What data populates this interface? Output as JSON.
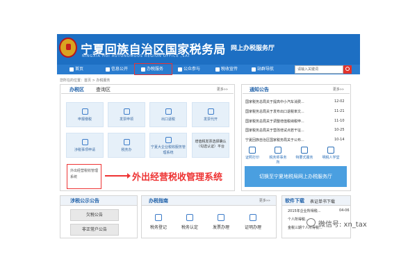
{
  "header": {
    "site_title": "宁夏回族自治区国家税务局",
    "site_title_en": "NINGXIA HUI AUTONOMOUS REGION OFFICE ,SAT",
    "hall_label": "网上办税服务厅"
  },
  "nav": {
    "items": [
      {
        "label": "首页",
        "icon": "home-icon"
      },
      {
        "label": "信息公开",
        "icon": "info-icon"
      },
      {
        "label": "办税服务",
        "icon": "edit-icon"
      },
      {
        "label": "公众参与",
        "icon": "people-icon"
      },
      {
        "label": "税收宣传",
        "icon": "news-icon"
      },
      {
        "label": "站群导航",
        "icon": "sitemap-icon"
      }
    ],
    "search_placeholder": "请输入关键词"
  },
  "breadcrumb": "您所在的位置：首页 > 办税服务",
  "tax_panel": {
    "tabs": [
      "办税区",
      "查询区"
    ],
    "more": "更多»»",
    "services": [
      {
        "label": "申报缴税",
        "icon": "declare-icon"
      },
      {
        "label": "发票申领",
        "icon": "invoice-icon"
      },
      {
        "label": "出口退税",
        "icon": "export-icon"
      },
      {
        "label": "发票代开",
        "icon": "print-icon"
      },
      {
        "label": "涉税事项申请",
        "icon": "apply-icon"
      },
      {
        "label": "税务办",
        "icon": "tax-office-icon"
      },
      {
        "label": "宁夏大企业税收服务管理系统",
        "icon": "enterprise-icon"
      }
    ],
    "confirm_text": "增值税发票选择确认（勾选认证）平台",
    "waichu_label": "外出经营税收管理系统"
  },
  "callout": "外出经营税收管理系统",
  "notice_panel": {
    "title": "通知公告",
    "more": "更多»»",
    "items": [
      {
        "text": "国家税务总局关于提高中小汽车消费...",
        "date": "12-02"
      },
      {
        "text": "国家税务总局关于发布出口退税率文...",
        "date": "11-21"
      },
      {
        "text": "国家税务总局关于调整增值税纳税申...",
        "date": "11-10"
      },
      {
        "text": "国家税务总局关于营改增试点若干征...",
        "date": "10-25"
      },
      {
        "text": "宁夏回族自治区国家税务局关于公布...",
        "date": "10-14"
      }
    ],
    "quick_links": [
      {
        "label": "证照打印",
        "icon": "certificate-icon"
      },
      {
        "label": "税务师事务所",
        "icon": "firm-icon"
      },
      {
        "label": "特要式服务",
        "icon": "service-icon"
      },
      {
        "label": "明税人学堂",
        "icon": "school-icon"
      }
    ],
    "switch_button": "切换至宁夏地税局网上办税服务厅"
  },
  "public_panel": {
    "title": "涉税公示公告",
    "buttons": [
      "欠税公告",
      "非正常户公告"
    ]
  },
  "guide_panel": {
    "title": "办税指南",
    "more": "更多»»",
    "items": [
      {
        "label": "税务登记",
        "icon": "register-icon"
      },
      {
        "label": "税务认定",
        "icon": "certify-icon"
      },
      {
        "label": "发票办理",
        "icon": "invoice-handle-icon"
      },
      {
        "label": "证明办理",
        "icon": "proof-icon"
      }
    ]
  },
  "download_panel": {
    "tabs": [
      "软件下载",
      "表证单书下载"
    ],
    "items": [
      {
        "text": "2015年企业所得税...",
        "date": "04-06"
      },
      {
        "text": "个人所得税...",
        "date": ""
      },
      {
        "text": "金税三期个人所得税...",
        "date": ""
      }
    ]
  },
  "watermark": "微信号: xn_tax",
  "colors": {
    "brand_blue": "#1d6fc3",
    "highlight_red": "#ee3333"
  }
}
